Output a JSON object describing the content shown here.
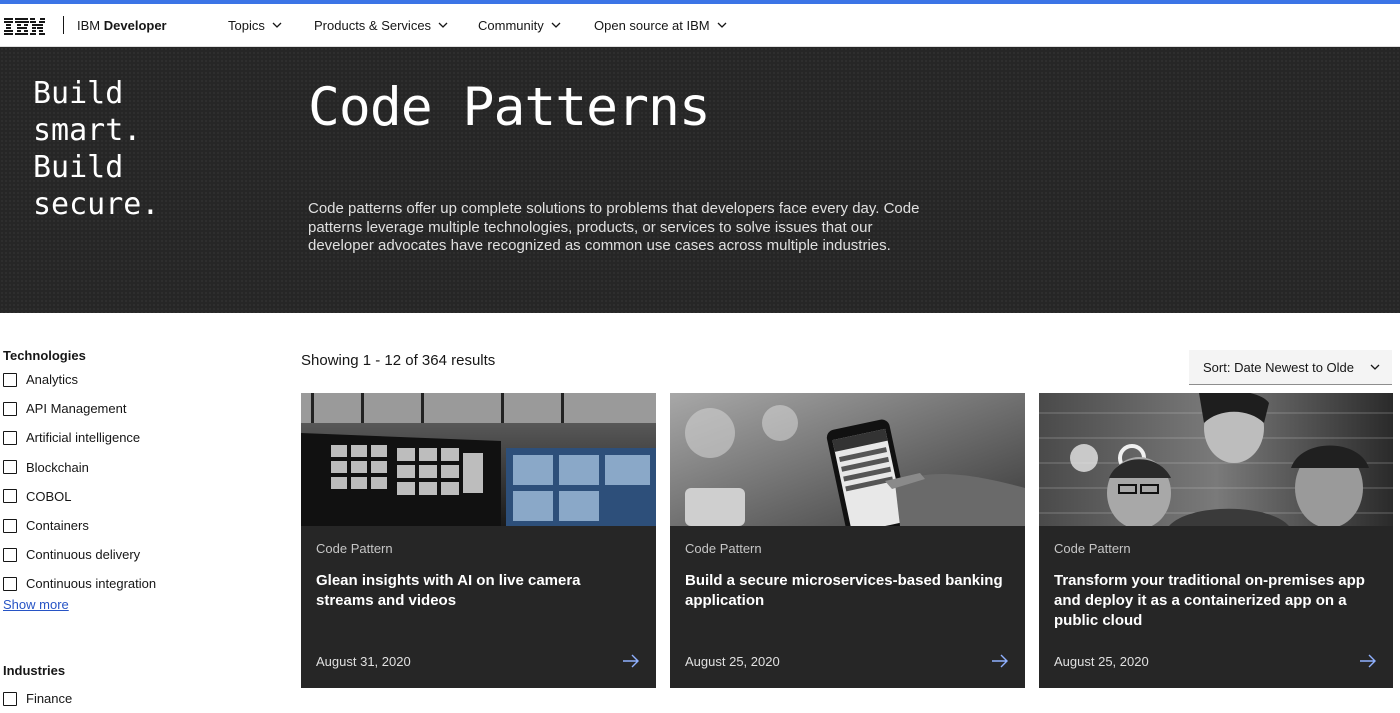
{
  "header": {
    "logo_text": "IBM",
    "brand_prefix": "IBM",
    "brand_name": "Developer",
    "menus": [
      "Topics",
      "Products & Services",
      "Community",
      "Open source at IBM"
    ],
    "accent_color": "#3b74e6"
  },
  "hero": {
    "tagline": "Build\nsmart.\nBuild\nsecure.",
    "title": "Code Patterns",
    "description": "Code patterns offer up complete solutions to problems that developers face every day. Code patterns leverage multiple technologies, products, or services to solve issues that our developer advocates have recognized as common use cases across multiple industries."
  },
  "filters": {
    "technologies_heading": "Technologies",
    "technologies": [
      "Analytics",
      "API Management",
      "Artificial intelligence",
      "Blockchain",
      "COBOL",
      "Containers",
      "Continuous delivery",
      "Continuous integration"
    ],
    "show_more": "Show more",
    "industries_heading": "Industries",
    "industries": [
      "Finance"
    ]
  },
  "results": {
    "count_text": "Showing 1 - 12 of 364 results",
    "sort_label": "Sort: Date Newest to Olde"
  },
  "cards": [
    {
      "type": "Code Pattern",
      "title": "Glean insights with AI on live camera streams and videos",
      "date": "August 31, 2020",
      "image": "camera-monitor-wall-image"
    },
    {
      "type": "Code Pattern",
      "title": "Build a secure microservices-based banking application",
      "date": "August 25, 2020",
      "image": "online-banking-phone-image"
    },
    {
      "type": "Code Pattern",
      "title": "Transform your traditional on-premises app and deploy it as a containerized app on a public cloud",
      "date": "August 25, 2020",
      "image": "developers-at-screen-image"
    }
  ]
}
